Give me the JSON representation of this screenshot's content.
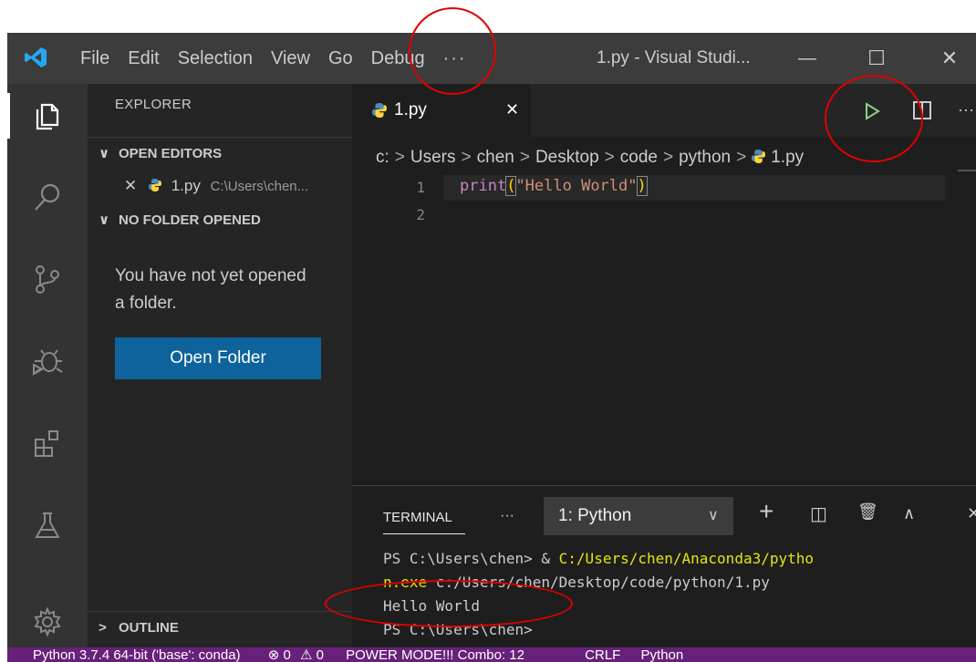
{
  "titlebar": {
    "menu": [
      "File",
      "Edit",
      "Selection",
      "View",
      "Go",
      "Debug",
      "···"
    ],
    "title": "1.py - Visual Studi...",
    "minimize": "—",
    "maximize": "☐",
    "close": "✕"
  },
  "sidebar": {
    "title": "EXPLORER",
    "open_editors": "OPEN EDITORS",
    "open_file_name": "1.py",
    "open_file_path": "C:\\Users\\chen...",
    "no_folder": "NO FOLDER OPENED",
    "message": "You have not yet opened a folder.",
    "open_folder_button": "Open Folder",
    "outline": "OUTLINE",
    "chevron_down": "∨",
    "chevron_right": ">"
  },
  "editor": {
    "tab_label": "1.py",
    "tab_close": "✕",
    "more_actions": "···",
    "breadcrumb": [
      "c:",
      "Users",
      "chen",
      "Desktop",
      "code",
      "python",
      "1.py"
    ],
    "breadcrumb_sep": ">",
    "line_numbers": [
      "1",
      "2"
    ],
    "code_func": "print",
    "code_open": "(",
    "code_string": "\"Hello World\"",
    "code_close": ")"
  },
  "panel": {
    "tab": "TERMINAL",
    "more": "···",
    "terminal_select": "1: Python",
    "select_chevron": "∨",
    "add": "+",
    "split": "◫",
    "trash": "🗑",
    "maximize": "∧",
    "close": "✕",
    "line1_prompt": "PS C:\\Users\\chen> & ",
    "line1_path": "C:/Users/chen/Anaconda3/pytho",
    "line2_path": "n.exe",
    "line2_rest": " c:/Users/chen/Desktop/code/python/1.py",
    "line3": "Hello World",
    "line4": "PS C:\\Users\\chen>"
  },
  "status": {
    "python": "Python 3.7.4 64-bit ('base': conda)",
    "errors": "⊗ 0",
    "warnings": "⚠ 0",
    "power_mode": "POWER MODE!!! Combo: 12",
    "eol": "CRLF",
    "language": "Python"
  },
  "colors": {
    "accent_blue": "#0e639c",
    "status_purple": "#68217a",
    "run_green": "#89d185",
    "annotation_red": "#e00000",
    "string_orange": "#ce9178",
    "keyword_blue": "#569cd6"
  }
}
